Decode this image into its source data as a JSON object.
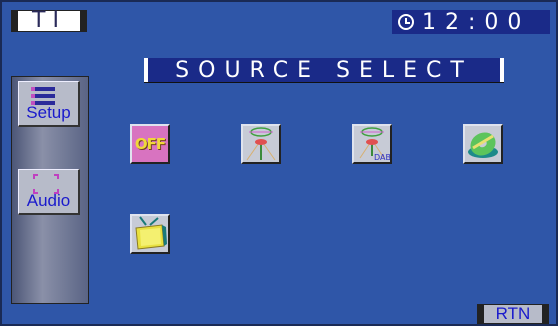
{
  "header": {
    "ti_label": "TI",
    "clock_time": "12:00",
    "clock_icon": "clock-icon"
  },
  "title": "SOURCE SELECT",
  "sidebar": {
    "items": [
      {
        "label": "Setup",
        "icon": "menu-lines-icon"
      },
      {
        "label": "Audio",
        "icon": "speaker-corners-icon"
      }
    ]
  },
  "sources": [
    {
      "name": "off",
      "label": "OFF",
      "icon": "off-icon"
    },
    {
      "name": "tuner",
      "icon": "radio-tuner-icon"
    },
    {
      "name": "dab",
      "label": "DAB",
      "icon": "dab-tuner-icon"
    },
    {
      "name": "cd",
      "icon": "disc-icon"
    },
    {
      "name": "tv",
      "icon": "tv-icon"
    }
  ],
  "footer": {
    "return_label": "RTN"
  }
}
